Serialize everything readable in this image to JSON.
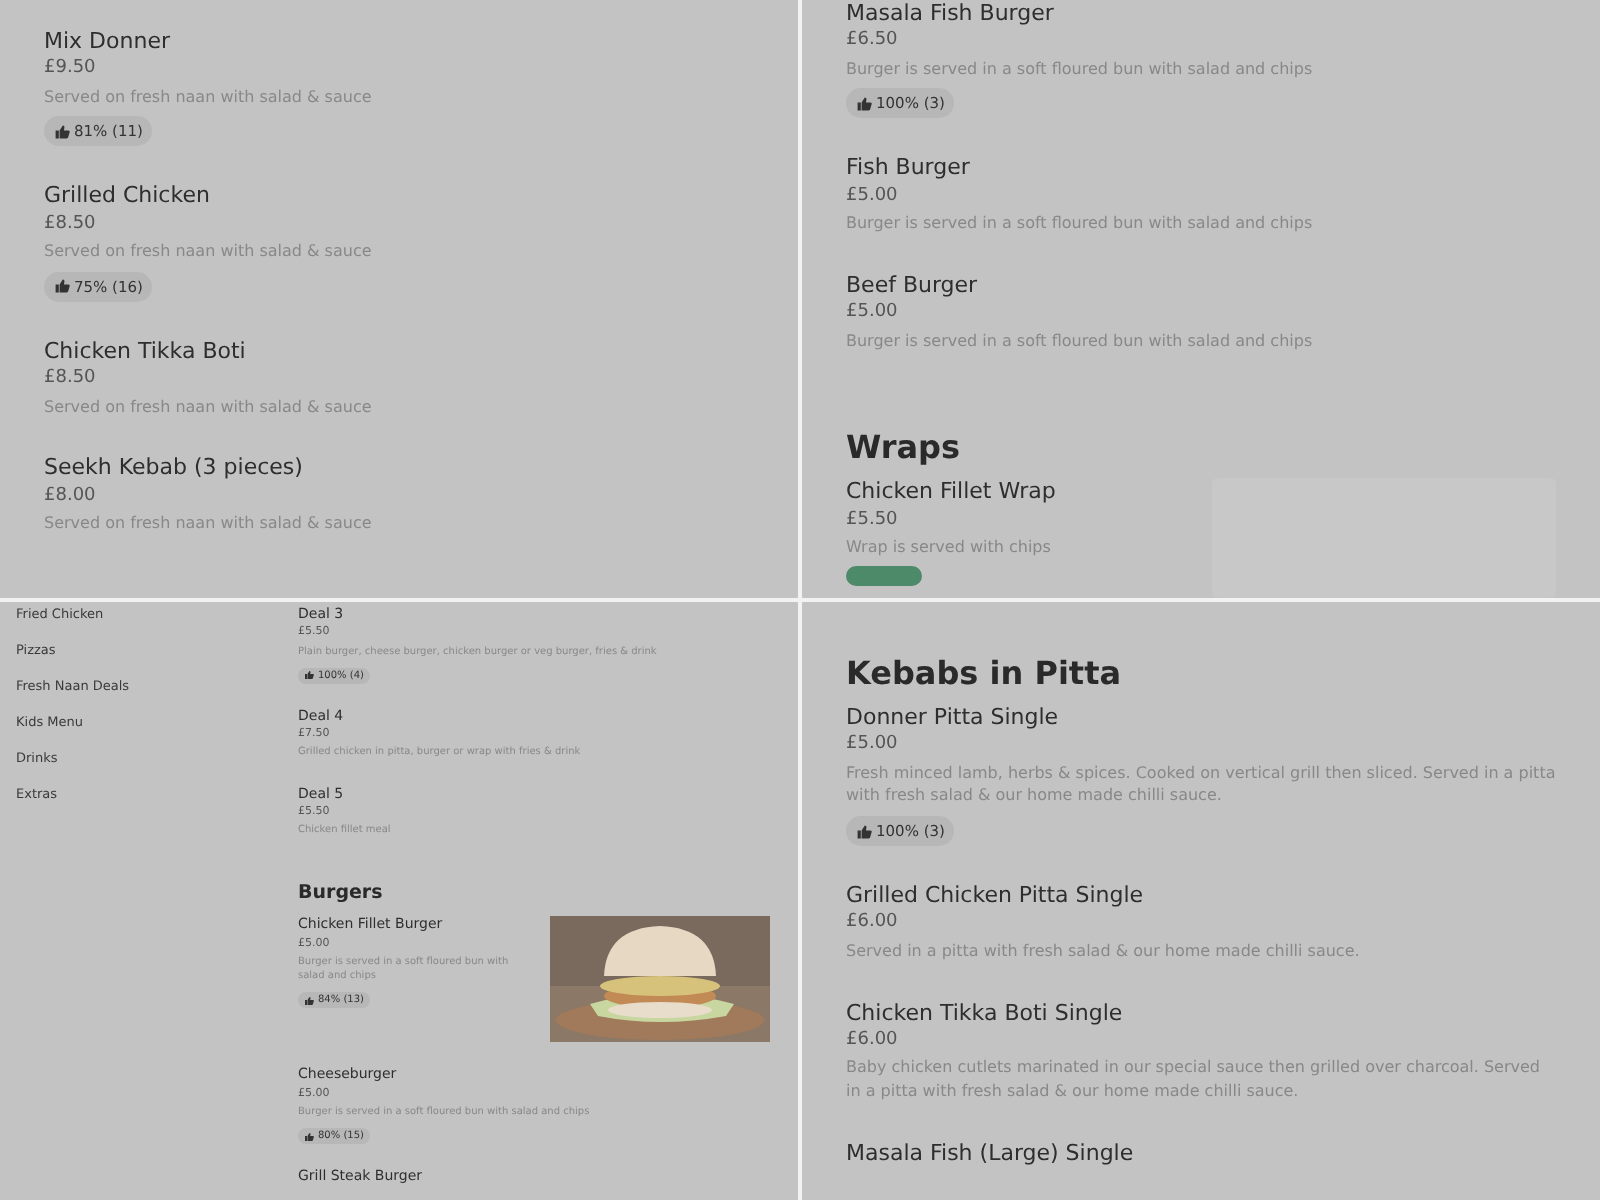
{
  "panels": [
    {
      "kind": "regular",
      "items": [
        {
          "kind": "item",
          "name": "Mix Donner",
          "price": "£9.50",
          "description": "Served on fresh naan with salad & sauce",
          "rating": "81% (11)"
        },
        {
          "kind": "item",
          "name": "Grilled Chicken",
          "price": "£8.50",
          "description": "Served on fresh naan with salad & sauce",
          "rating": "75% (16)"
        },
        {
          "kind": "item",
          "name": "Chicken Tikka Boti",
          "price": "£8.50",
          "description": "Served on fresh naan with salad & sauce"
        },
        {
          "kind": "item",
          "name": "Seekh Kebab (3 pieces)",
          "price": "£8.00",
          "description": "Served on fresh naan with salad & sauce"
        }
      ]
    },
    {
      "kind": "regular",
      "items": [
        {
          "kind": "item",
          "name": "Masala Fish Burger",
          "price": "£6.50",
          "description": "Burger is served in a soft floured bun with salad and chips",
          "rating": "100% (3)"
        },
        {
          "kind": "item",
          "name": "Fish Burger",
          "price": "£5.00",
          "description": "Burger is served in a soft floured bun with salad and chips"
        },
        {
          "kind": "item",
          "name": "Beef Burger",
          "price": "£5.00",
          "description": "Burger is served in a soft floured bun with salad and chips"
        },
        {
          "kind": "section",
          "title": "Wraps"
        },
        {
          "kind": "item_with_placeholder",
          "name": "Chicken Fillet Wrap",
          "price": "£5.50",
          "description": "Wrap is served with chips",
          "tag": true
        }
      ]
    },
    {
      "kind": "compact",
      "sidebar": [
        "Fried Chicken",
        "Pizzas",
        "Fresh Naan Deals",
        "Kids Menu",
        "Drinks",
        "Extras"
      ],
      "items": [
        {
          "kind": "item",
          "name": "Deal 3",
          "price": "£5.50",
          "description": "Plain burger, cheese burger, chicken burger or veg burger, fries & drink",
          "rating": "100% (4)"
        },
        {
          "kind": "item",
          "name": "Deal 4",
          "price": "£7.50",
          "description": "Grilled chicken in pitta, burger or wrap with fries & drink"
        },
        {
          "kind": "item",
          "name": "Deal 5",
          "price": "£5.50",
          "description": "Chicken fillet meal"
        },
        {
          "kind": "section",
          "title": "Burgers"
        },
        {
          "kind": "item_with_photo",
          "name": "Chicken Fillet Burger",
          "price": "£5.00",
          "description": "Burger is served in a soft floured bun with salad and chips",
          "rating": "84% (13)"
        },
        {
          "kind": "item",
          "name": "Cheeseburger",
          "price": "£5.00",
          "description": "Burger is served in a soft floured bun with salad and chips",
          "rating": "80% (15)"
        },
        {
          "kind": "item",
          "name": "Grill Steak Burger"
        }
      ]
    },
    {
      "kind": "regular",
      "items": [
        {
          "kind": "section",
          "title": "Kebabs in Pitta"
        },
        {
          "kind": "item",
          "name": "Donner Pitta Single",
          "price": "£5.00",
          "description": "Fresh minced lamb, herbs & spices. Cooked on vertical grill then sliced. Served in a pitta with fresh salad & our home made chilli sauce.",
          "rating": "100% (3)"
        },
        {
          "kind": "item",
          "name": "Grilled Chicken Pitta Single",
          "price": "£6.00",
          "description": "Served in a pitta with fresh salad & our home made chilli sauce."
        },
        {
          "kind": "item",
          "name": "Chicken Tikka Boti Single",
          "price": "£6.00",
          "description": "Baby chicken cutlets marinated in our special sauce then grilled over charcoal. Served in a pitta with fresh salad & our home made chilli sauce."
        },
        {
          "kind": "item",
          "name": "Masala Fish (Large) Single"
        }
      ]
    }
  ]
}
